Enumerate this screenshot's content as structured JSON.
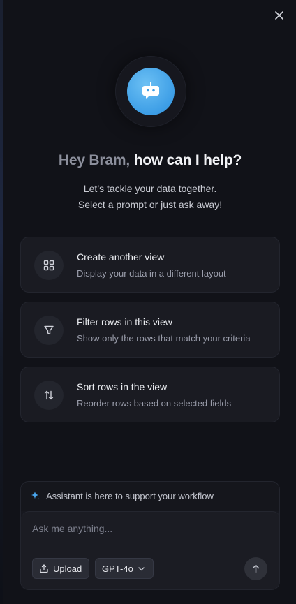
{
  "header": {
    "close_icon": "close-icon"
  },
  "assistant": {
    "avatar_icon": "robot-chat-icon"
  },
  "greeting": {
    "name_part": "Hey Bram,",
    "question_part": "how can I help?"
  },
  "subtitle": {
    "line1": "Let’s tackle your data together.",
    "line2": "Select a prompt or just ask away!"
  },
  "prompts": [
    {
      "title": "Create another view",
      "description": "Display your data in a different layout",
      "icon": "grid-icon"
    },
    {
      "title": "Filter rows in this view",
      "description": "Show only the rows that match your criteria",
      "icon": "filter-icon"
    },
    {
      "title": "Sort rows in the view",
      "description": "Reorder rows based on selected fields",
      "icon": "sort-icon"
    }
  ],
  "composer": {
    "notice": "Assistant is here to support your workflow",
    "notice_icon": "sparkle-icon",
    "placeholder": "Ask me anything...",
    "upload_label": "Upload",
    "model_label": "GPT-4o",
    "send_icon": "arrow-up-icon"
  },
  "colors": {
    "accent": "#3d9ee6",
    "background": "#111218",
    "card": "#1a1b22"
  }
}
